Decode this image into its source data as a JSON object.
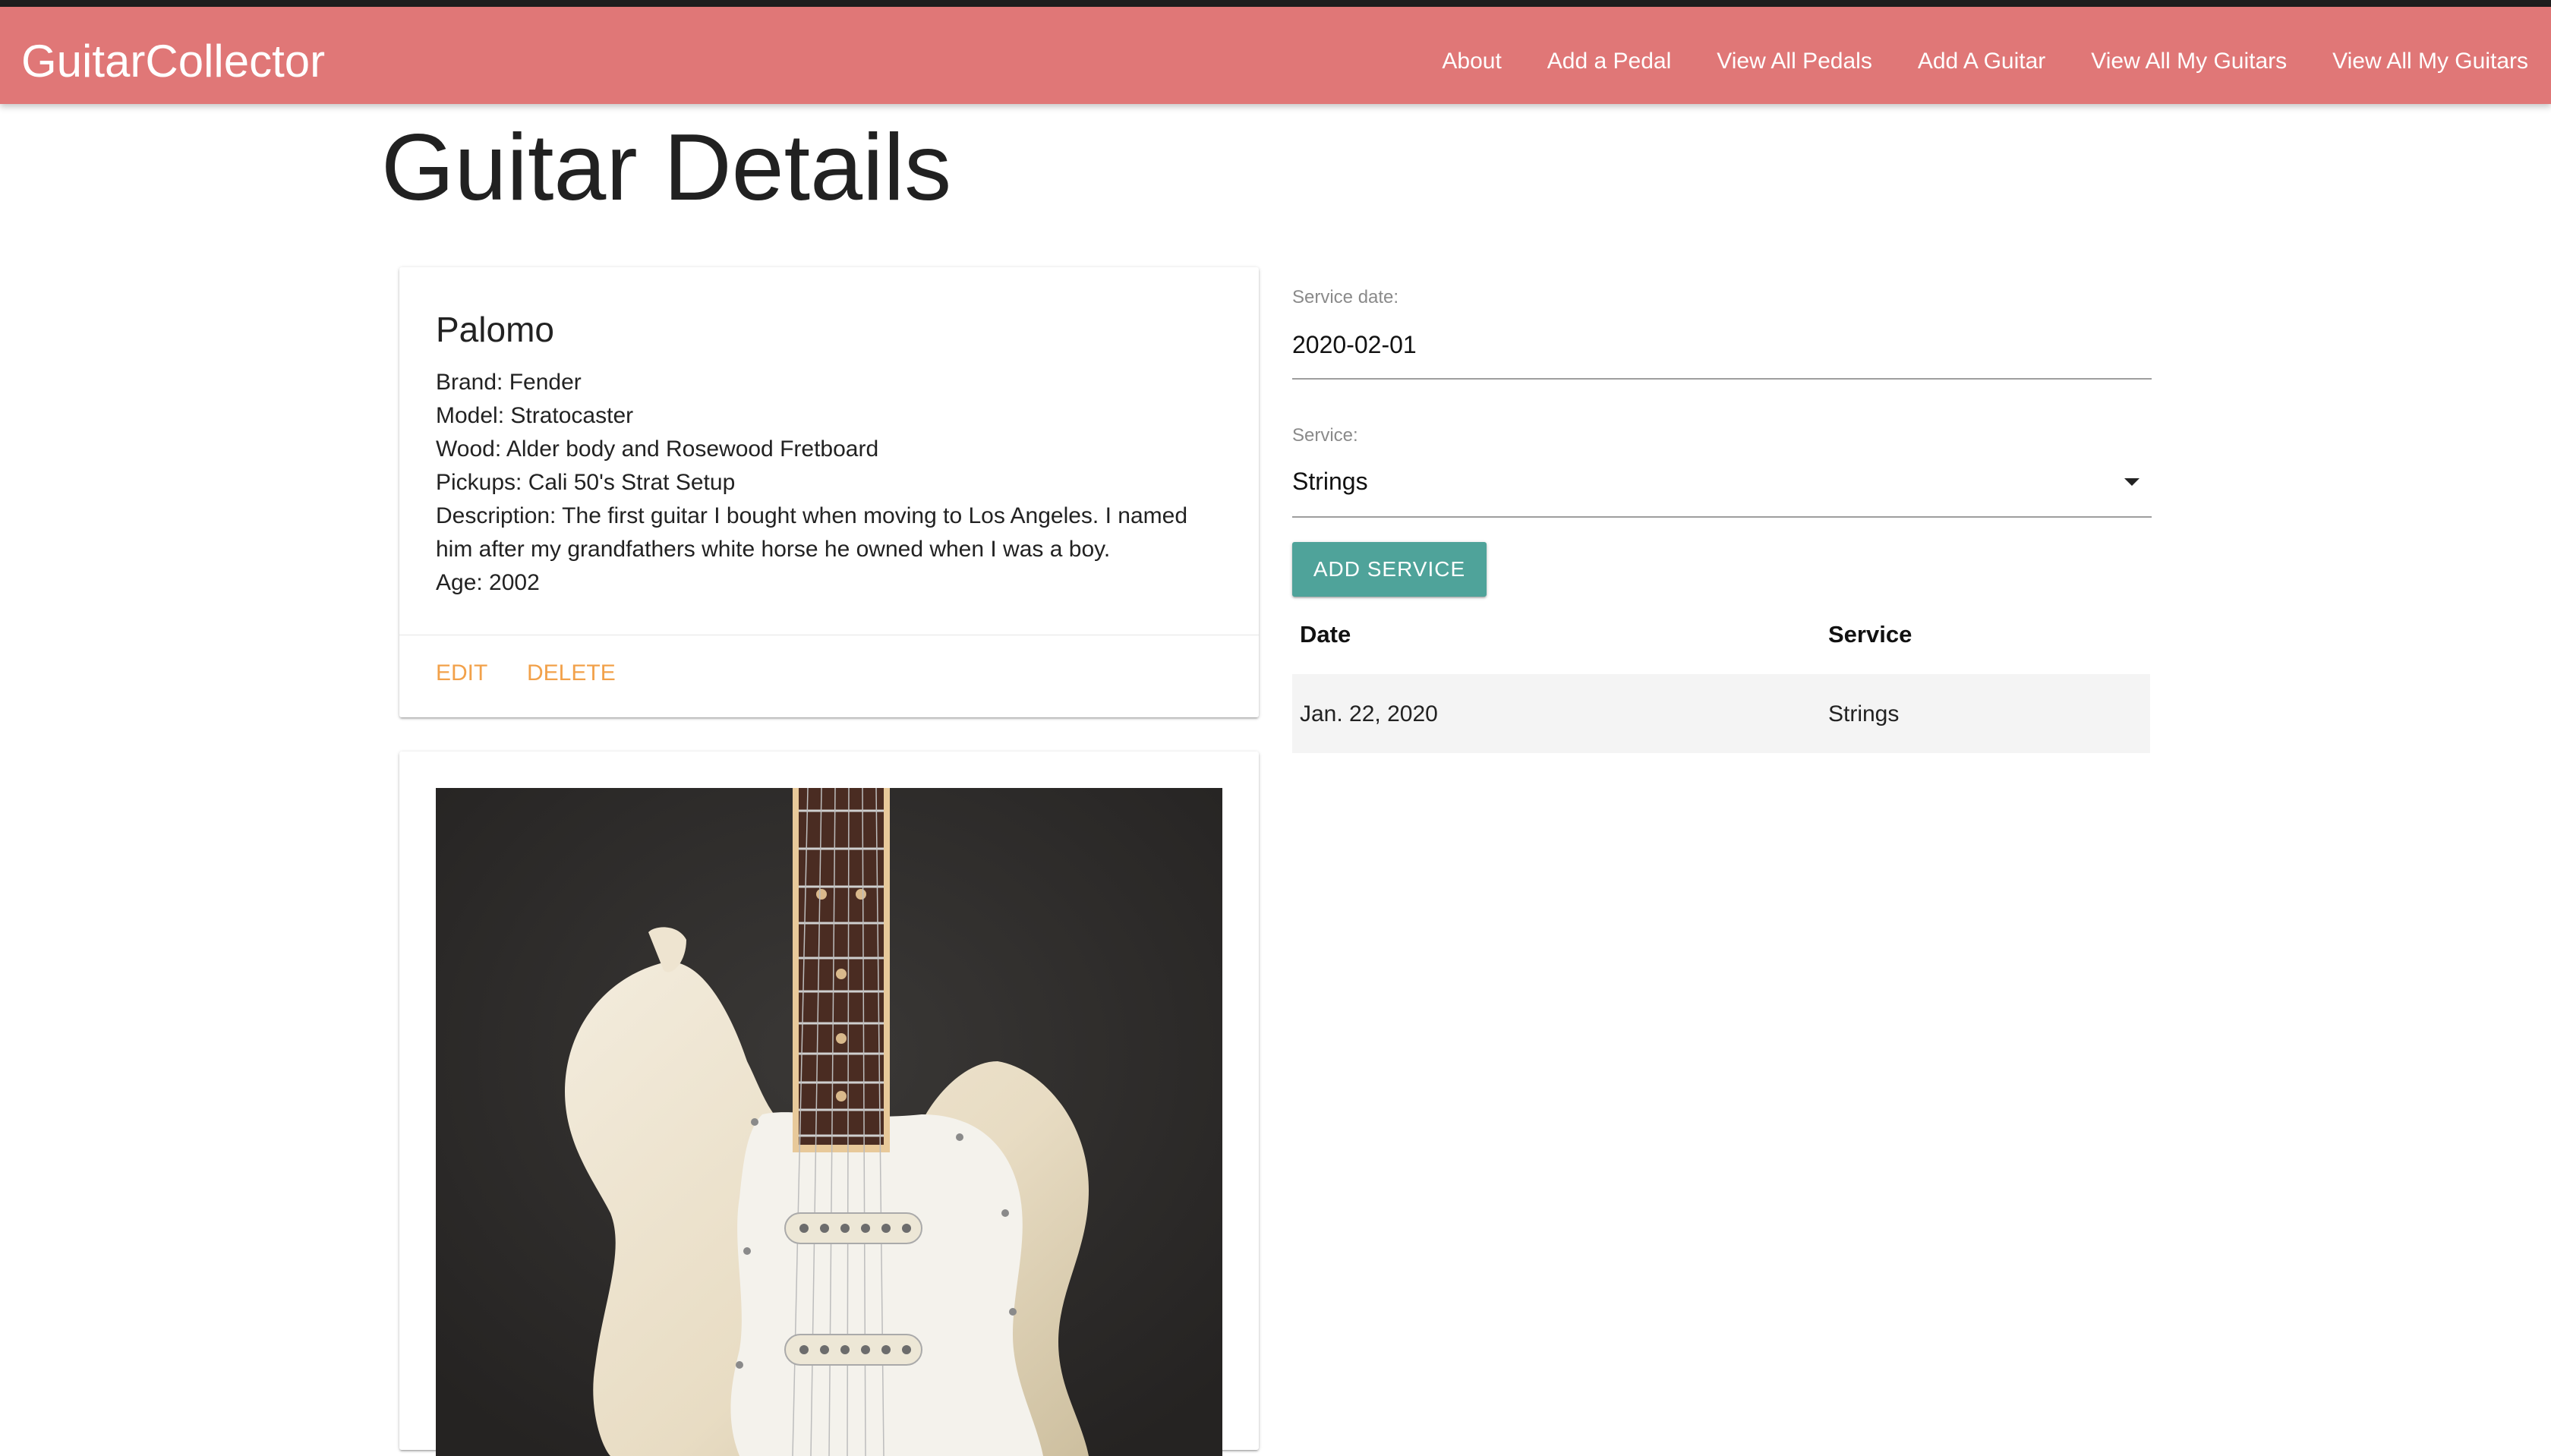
{
  "nav": {
    "brand": "GuitarCollector",
    "links": [
      "About",
      "Add a Pedal",
      "View All Pedals",
      "Add A Guitar",
      "View All My Guitars",
      "View All My Guitars"
    ]
  },
  "page": {
    "title": "Guitar Details"
  },
  "guitar": {
    "name": "Palomo",
    "brand": "Brand: Fender",
    "model": "Model: Stratocaster",
    "wood": "Wood: Alder body and Rosewood Fretboard",
    "pickups": "Pickups: Cali 50's Strat Setup",
    "description": "Description: The first guitar I bought when moving to Los Angeles. I named him after my grandfathers white horse he owned when I was a boy.",
    "age": "Age: 2002",
    "actions": {
      "edit": "EDIT",
      "delete": "DELETE"
    }
  },
  "service_form": {
    "date_label": "Service date:",
    "date_value": "2020-02-01",
    "service_label": "Service:",
    "service_value": "Strings",
    "add_button": "ADD SERVICE"
  },
  "service_table": {
    "headers": {
      "date": "Date",
      "service": "Service"
    },
    "rows": [
      {
        "date": "Jan. 22, 2020",
        "service": "Strings"
      }
    ]
  },
  "colors": {
    "navbar": "#e07777",
    "accent_button": "#4fa39a",
    "action_text": "#f2a14a"
  },
  "icons": {
    "select_caret": "caret-down-icon"
  }
}
